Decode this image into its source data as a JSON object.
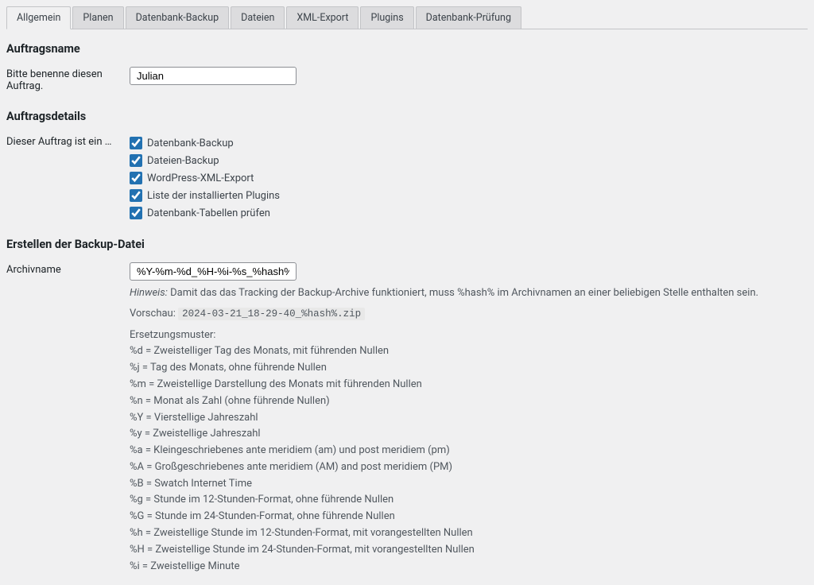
{
  "tabs": [
    {
      "label": "Allgemein",
      "active": true
    },
    {
      "label": "Planen",
      "active": false
    },
    {
      "label": "Datenbank-Backup",
      "active": false
    },
    {
      "label": "Dateien",
      "active": false
    },
    {
      "label": "XML-Export",
      "active": false
    },
    {
      "label": "Plugins",
      "active": false
    },
    {
      "label": "Datenbank-Prüfung",
      "active": false
    }
  ],
  "section_jobname": {
    "heading": "Auftragsname",
    "label": "Bitte benenne diesen Auftrag.",
    "value": "Julian"
  },
  "section_jobdetails": {
    "heading": "Auftragsdetails",
    "label": "Dieser Auftrag ist ein …",
    "options": [
      {
        "label": "Datenbank-Backup",
        "checked": true
      },
      {
        "label": "Dateien-Backup",
        "checked": true
      },
      {
        "label": "WordPress-XML-Export",
        "checked": true
      },
      {
        "label": "Liste der installierten Plugins",
        "checked": true
      },
      {
        "label": "Datenbank-Tabellen prüfen",
        "checked": true
      }
    ]
  },
  "section_backupfile": {
    "heading": "Erstellen der Backup-Datei",
    "archive_label": "Archivname",
    "archive_value": "%Y-%m-%d_%H-%i-%s_%hash%",
    "hint_label": "Hinweis:",
    "hint_text": "Damit das das Tracking der Backup-Archive funktioniert, muss %hash% im Archivnamen an einer beliebigen Stelle enthalten sein.",
    "preview_label": "Vorschau:",
    "preview_value": "2024-03-21_18-29-40_%hash%.zip",
    "patterns_header": "Ersetzungsmuster:",
    "patterns": [
      "%d = Zweistelliger Tag des Monats, mit führenden Nullen",
      "%j = Tag des Monats, ohne führende Nullen",
      "%m = Zweistellige Darstellung des Monats mit führenden Nullen",
      "%n = Monat als Zahl (ohne führende Nullen)",
      "%Y = Vierstellige Jahreszahl",
      "%y = Zweistellige Jahreszahl",
      "%a = Kleingeschriebenes ante meridiem (am) und post meridiem (pm)",
      "%A = Großgeschriebenes ante meridiem (AM) and post meridiem (PM)",
      "%B = Swatch Internet Time",
      "%g = Stunde im 12-Stunden-Format, ohne führende Nullen",
      "%G = Stunde im 24-Stunden-Format, ohne führende Nullen",
      "%h = Zweistellige Stunde im 12-Stunden-Format, mit vorangestellten Nullen",
      "%H = Zweistellige Stunde im 24-Stunden-Format, mit vorangestellten Nullen",
      "%i = Zweistellige Minute"
    ]
  }
}
